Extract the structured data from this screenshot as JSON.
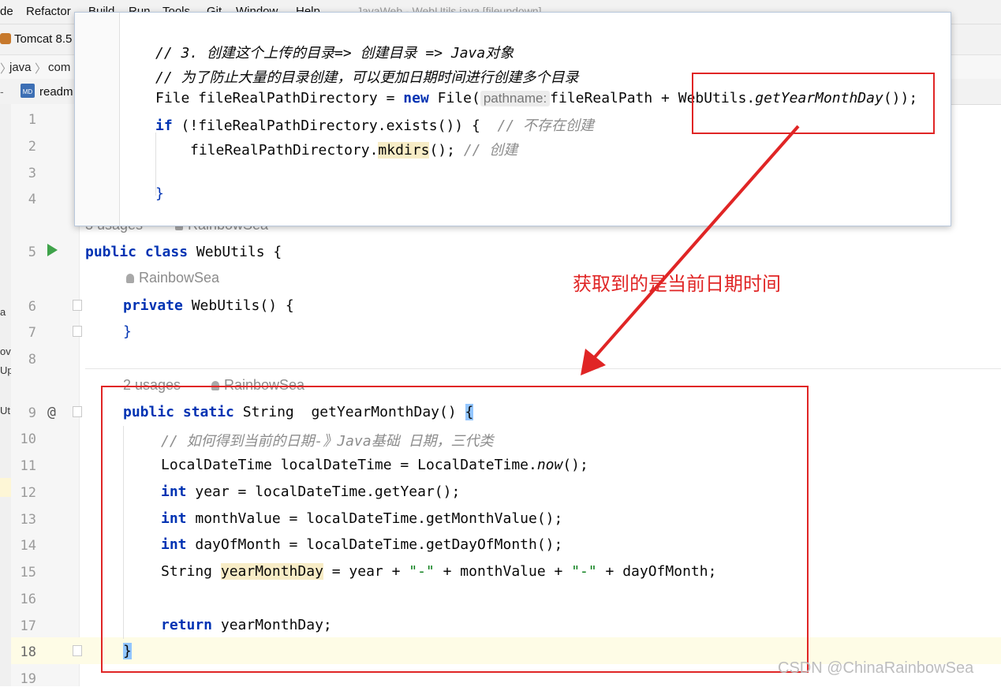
{
  "menubar": {
    "items": [
      "de",
      "Refactor",
      "Build",
      "Run",
      "Tools",
      "Git",
      "Window",
      "Help"
    ],
    "window_title": "JavaWeb - WebUtils.java [fileupdown]"
  },
  "runbar": {
    "config": "Tomcat 8.5"
  },
  "navbar": {
    "crumbs": [
      "java",
      "com"
    ]
  },
  "tabs": {
    "readme": "readm",
    "md_icon": "MD"
  },
  "left_strip": {
    "frags": [
      "a",
      "ov",
      "Upl",
      "Ut"
    ]
  },
  "gutter": {
    "lines": [
      "1",
      "2",
      "3",
      "4",
      "5",
      "6",
      "7",
      "8",
      "9",
      "10",
      "11",
      "12",
      "13",
      "14",
      "15",
      "16",
      "17",
      "18",
      "19"
    ],
    "run_icon": "run-gutter-icon",
    "override_marker": "@"
  },
  "popup": {
    "line1": "// 3. 创建这个上传的目录=> 创建目录 => Java对象",
    "line2": "// 为了防止大量的目录创建，可以更加日期时间进行创建多个目录",
    "line3_a": "File fileRealPathDirectory = ",
    "line3_new": "new",
    "line3_b": " File(",
    "line3_hint": "pathname:",
    "line3_c": "fileRealPath + WebUtils.",
    "line3_method": "getYearMonthDay",
    "line3_d": "());",
    "line4_if": "if",
    "line4_a": " (!fileRealPathDirectory.exists()) {  ",
    "line4_comment": "// 不存在创建",
    "line5_a": "fileRealPathDirectory.",
    "line5_method": "mkdirs",
    "line5_b": "(); ",
    "line5_comment": "// 创建",
    "line7": "}"
  },
  "editor": {
    "usages_class": "3 usages",
    "author": "RainbowSea",
    "class_kw1": "public",
    "class_kw2": "class",
    "class_name": " WebUtils {",
    "ctor_author": "RainbowSea",
    "ctor_kw": "private",
    "ctor_rest": " WebUtils() {",
    "ctor_close": "}",
    "usages_method": "2 usages",
    "method_author": "RainbowSea",
    "m_kw1": "public",
    "m_kw2": "static",
    "m_rest": " String  getYearMonthDay() ",
    "m_brace": "{",
    "l10": "// 如何得到当前的日期-》Java基础 日期，三代类",
    "l11_a": "LocalDateTime localDateTime = LocalDateTime.",
    "l11_now": "now",
    "l11_b": "();",
    "l12_kw": "int",
    "l12": " year = localDateTime.getYear();",
    "l13_kw": "int",
    "l13": " monthValue = localDateTime.getMonthValue();",
    "l14_kw": "int",
    "l14": " dayOfMonth = localDateTime.getDayOfMonth();",
    "l15_a": "String ",
    "l15_var": "yearMonthDay",
    "l15_b": " = year + ",
    "l15_s1": "\"-\"",
    "l15_c": " + monthValue + ",
    "l15_s2": "\"-\"",
    "l15_d": " + dayOfMonth;",
    "l17_kw": "return",
    "l17": " yearMonthDay;",
    "l18": "}"
  },
  "annotation": {
    "text": "获取到的是当前日期时间",
    "color": "#e02525"
  },
  "watermark": "CSDN @ChinaRainbowSea"
}
